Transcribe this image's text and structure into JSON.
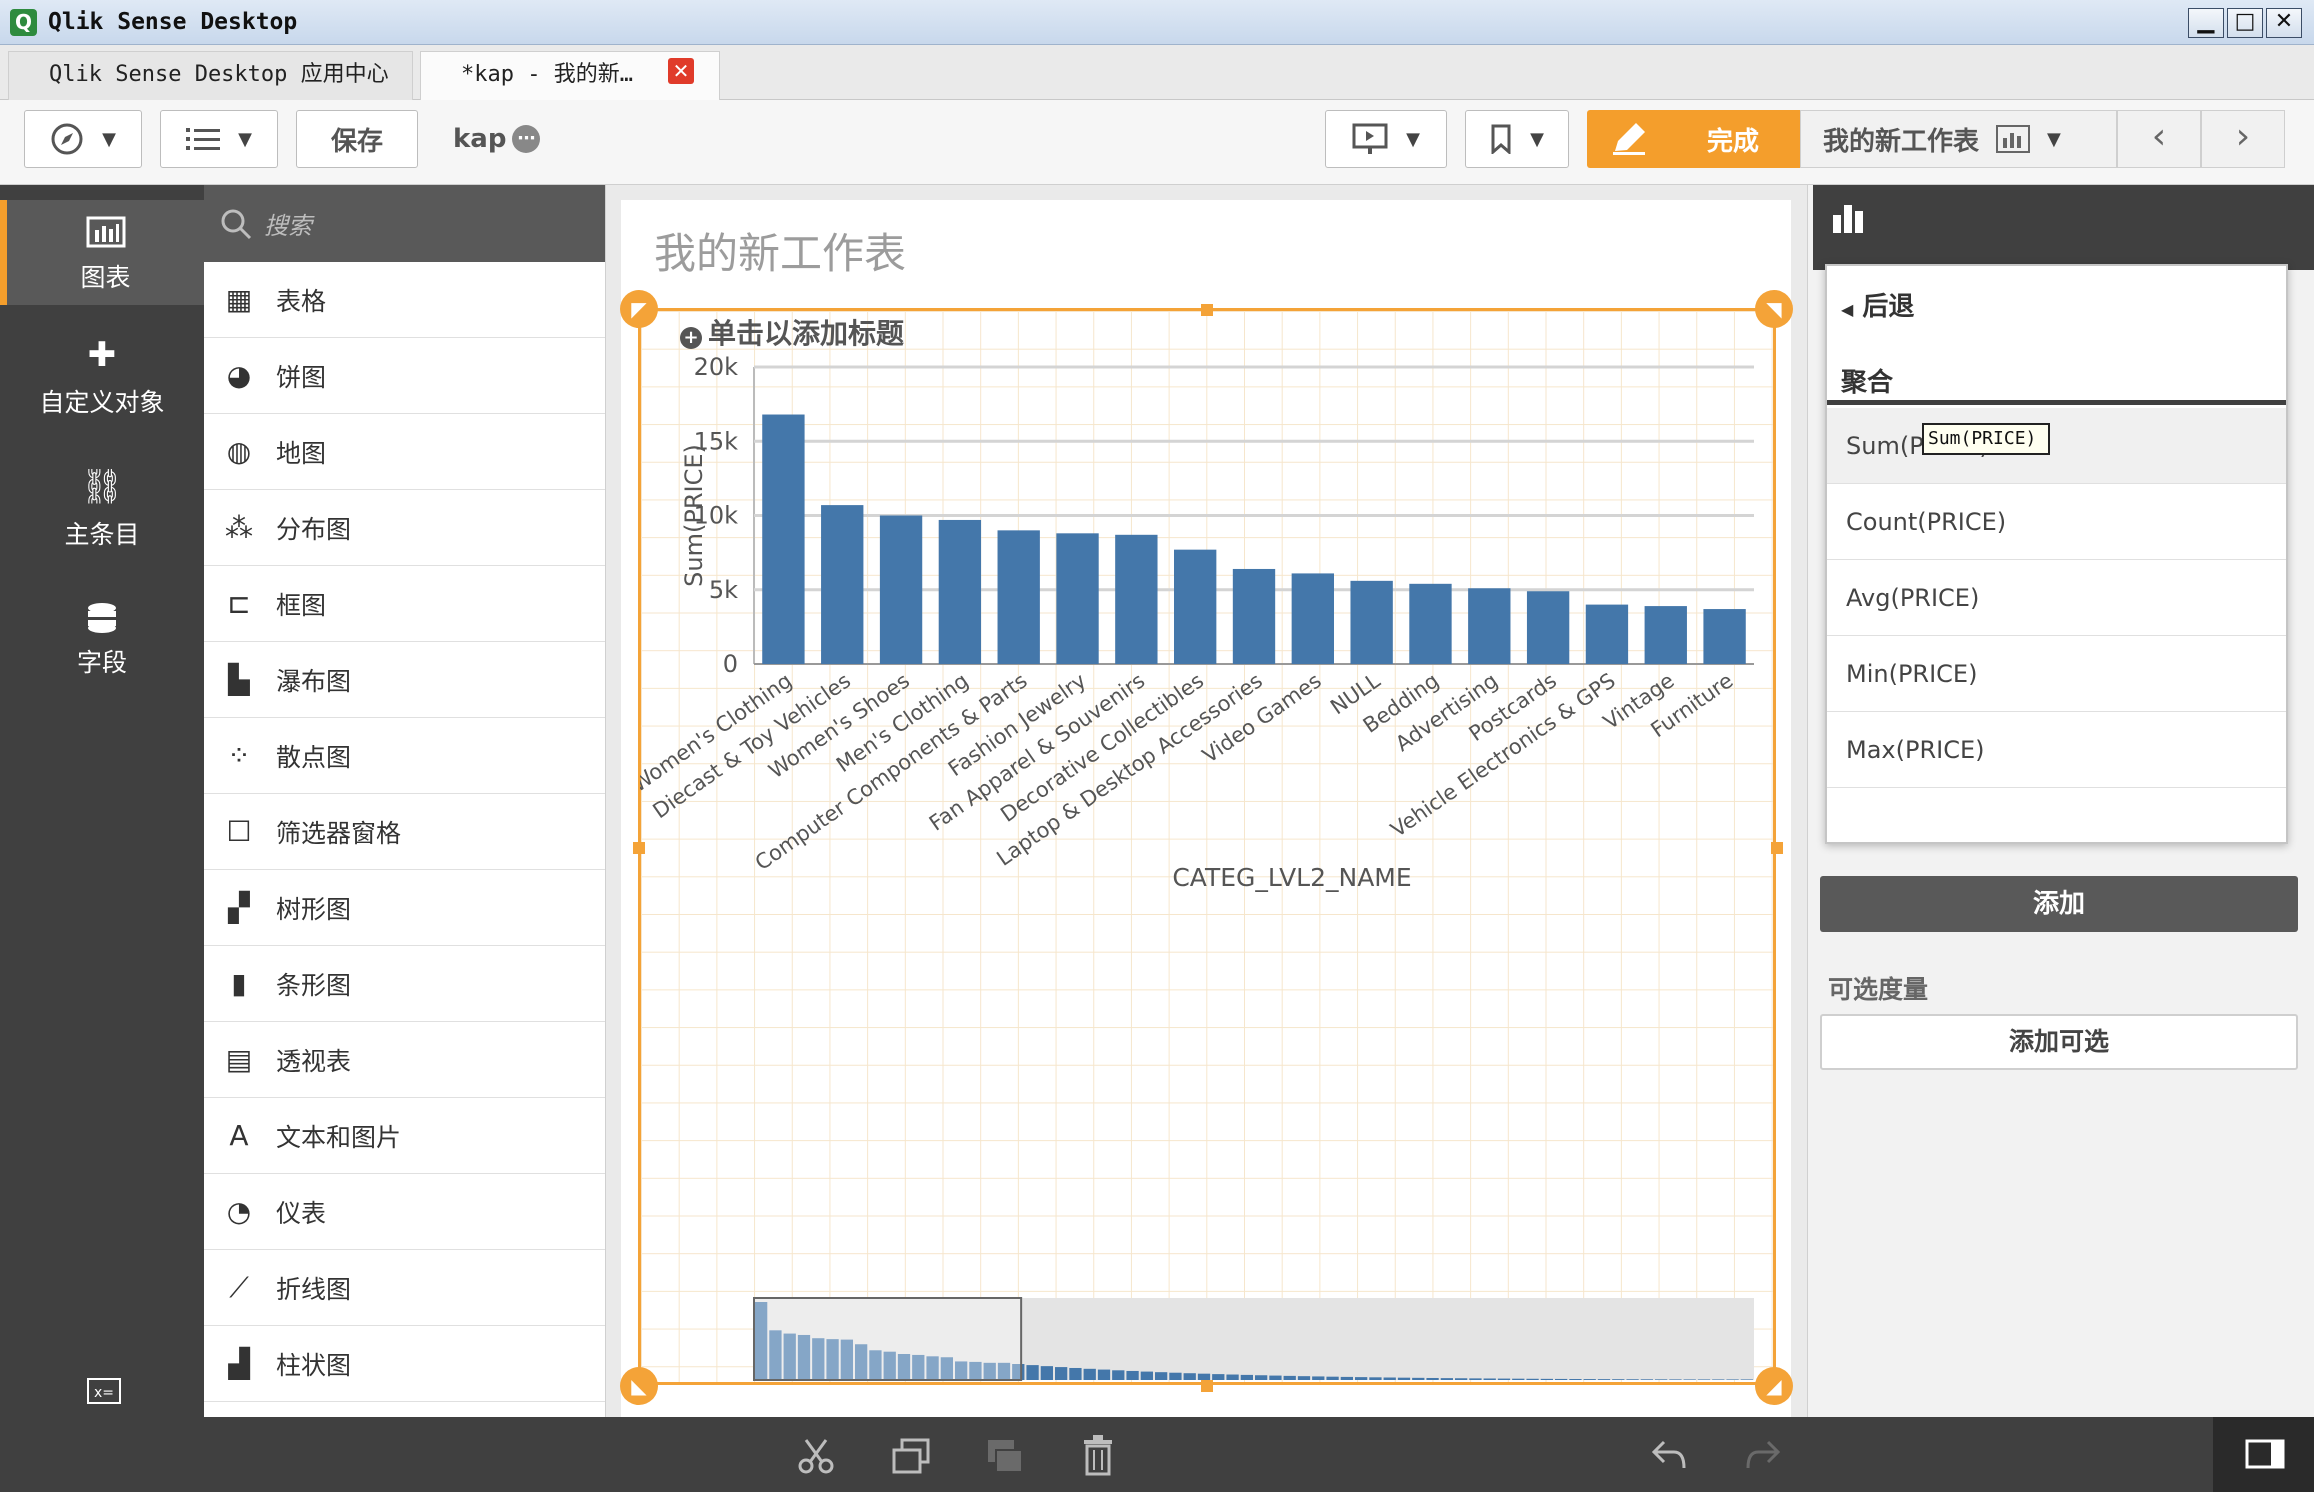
{
  "window": {
    "title": "Qlik Sense Desktop",
    "app_icon": "qlik-q-icon",
    "min": "▁",
    "max": "□",
    "close": "✕"
  },
  "tabs": [
    {
      "label": "Qlik Sense Desktop 应用中心"
    },
    {
      "label": "*kap - 我的新…",
      "close": "✕"
    }
  ],
  "toolbar": {
    "save": "保存",
    "app_name": "kap",
    "done": "完成",
    "sheet_name": "我的新工作表",
    "prev": "‹",
    "next": "›"
  },
  "rail": [
    {
      "label": "图表",
      "icon": "chart-icon"
    },
    {
      "label": "自定义对象",
      "icon": "puzzle-icon"
    },
    {
      "label": "主条目",
      "icon": "link-icon"
    },
    {
      "label": "字段",
      "icon": "database-icon"
    }
  ],
  "assets": {
    "search_placeholder": "搜索",
    "items": [
      {
        "label": "表格",
        "icon": "table-icon",
        "glyph": "▦"
      },
      {
        "label": "饼图",
        "icon": "pie-icon",
        "glyph": "◕"
      },
      {
        "label": "地图",
        "icon": "globe-icon",
        "glyph": "◍"
      },
      {
        "label": "分布图",
        "icon": "distribution-icon",
        "glyph": "⁂"
      },
      {
        "label": "框图",
        "icon": "boxplot-icon",
        "glyph": "⊏"
      },
      {
        "label": "瀑布图",
        "icon": "waterfall-icon",
        "glyph": "▙"
      },
      {
        "label": "散点图",
        "icon": "scatter-icon",
        "glyph": "⁘"
      },
      {
        "label": "筛选器窗格",
        "icon": "filter-pane-icon",
        "glyph": "☐"
      },
      {
        "label": "树形图",
        "icon": "treemap-icon",
        "glyph": "▞"
      },
      {
        "label": "条形图",
        "icon": "bar-chart-icon",
        "glyph": "▮"
      },
      {
        "label": "透视表",
        "icon": "pivot-icon",
        "glyph": "▤"
      },
      {
        "label": "文本和图片",
        "icon": "text-image-icon",
        "glyph": "A"
      },
      {
        "label": "仪表",
        "icon": "gauge-icon",
        "glyph": "◔"
      },
      {
        "label": "折线图",
        "icon": "line-chart-icon",
        "glyph": "⟋"
      },
      {
        "label": "柱状图",
        "icon": "combo-chart-icon",
        "glyph": "▟"
      }
    ]
  },
  "sheet": {
    "title": "我的新工作表",
    "add_title": "单击以添加标题"
  },
  "properties": {
    "back": "后退",
    "group": "聚合",
    "items": [
      "Sum(PRICE)",
      "Count(PRICE)",
      "Avg(PRICE)",
      "Min(PRICE)",
      "Max(PRICE)"
    ],
    "tooltip": "Sum(PRICE)",
    "add": "添加",
    "optional_label": "可选度量",
    "add_optional": "添加可选"
  },
  "colors": {
    "accent": "#f49e2c",
    "bar": "#4477aa",
    "rail": "#404040"
  },
  "chart_data": {
    "type": "bar",
    "ylabel": "Sum(PRICE)",
    "xlabel": "CATEG_LVL2_NAME",
    "ylim": [
      0,
      20000
    ],
    "yticks": [
      "0",
      "5k",
      "10k",
      "15k",
      "20k"
    ],
    "categories": [
      "Women's Clothing",
      "Diecast & Toy Vehicles",
      "Women's Shoes",
      "Men's Clothing",
      "Computer Components & Parts",
      "Fashion Jewelry",
      "Fan Apparel & Souvenirs",
      "Decorative Collectibles",
      "Laptop & Desktop Accessories",
      "Video Games",
      "NULL",
      "Bedding",
      "Advertising",
      "Postcards",
      "Vehicle Electronics & GPS",
      "Vintage",
      "Furniture"
    ],
    "values": [
      16800,
      10700,
      10000,
      9700,
      9000,
      8800,
      8700,
      7700,
      6400,
      6100,
      5600,
      5400,
      5100,
      4900,
      4000,
      3900,
      3700
    ]
  }
}
